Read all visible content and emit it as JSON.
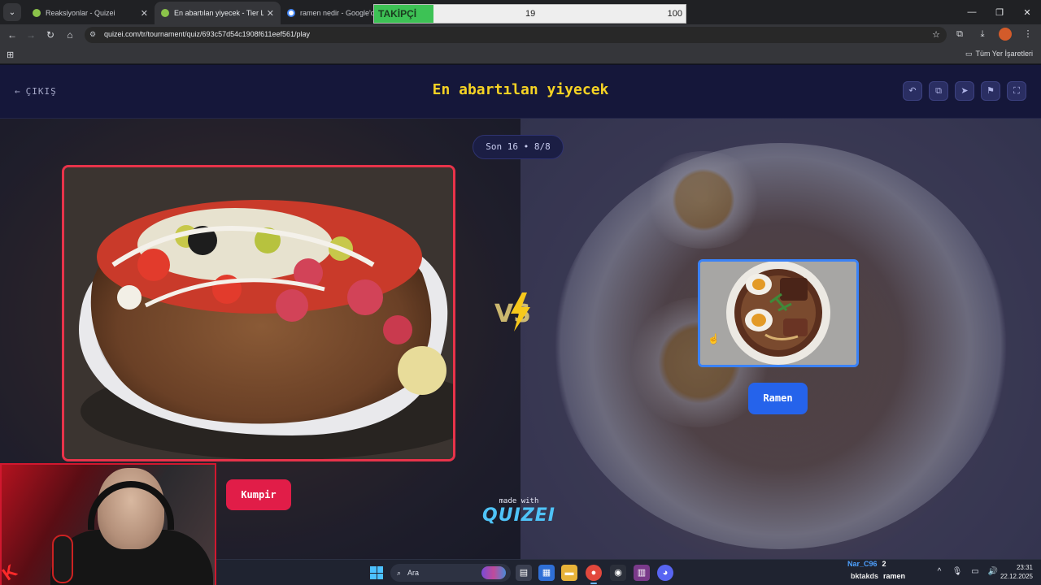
{
  "browser": {
    "tabs": [
      {
        "title": "Reaksiyonlar - Quizei",
        "active": false
      },
      {
        "title": "En abartılan yiyecek - Tier List, ...",
        "active": true
      },
      {
        "title": "ramen nedir - Google'da A",
        "active": false
      }
    ],
    "tab_close": "✕",
    "url": "quizei.com/tr/tournament/quiz/693c57d54c1908f611eef561/play",
    "bookmarks_label": "Tüm Yer İşaretleri"
  },
  "follower_bar": {
    "label": "TAKİPÇİ",
    "current": "19",
    "goal": "100",
    "progress": 0.19
  },
  "quiz": {
    "exit_label": "ÇIKIŞ",
    "title": "En abartılan yiyecek",
    "round": "Son 16 • 8/8",
    "left_option": {
      "label": "Kumpir",
      "image": "kumpir-baked-potato"
    },
    "right_option": {
      "label": "Ramen",
      "image": "ramen-bowl"
    },
    "vs": "VS",
    "made_with": "made with",
    "brand": "QUIZEI"
  },
  "header_buttons": [
    "undo-icon",
    "share-icon",
    "send-icon",
    "flag-icon",
    "fullscreen-icon"
  ],
  "colors": {
    "title": "#f5d224",
    "left_accent": "#e11d48",
    "right_accent": "#2563eb",
    "follower_fill": "#3dc255"
  },
  "taskbar": {
    "search_label": "Ara",
    "chat": [
      {
        "user": "Nar_C96",
        "message": "2"
      },
      {
        "user": "bktakds",
        "message": "ramen"
      }
    ],
    "time": "23:31",
    "date": "22.12.2025"
  }
}
